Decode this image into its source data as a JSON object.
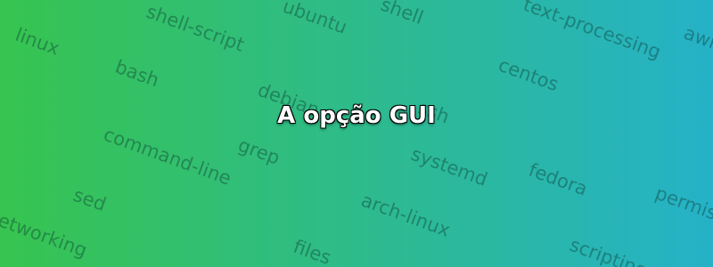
{
  "banner": {
    "gradient_start": "#37c44f",
    "gradient_end": "#25b2c8",
    "title": "A opção GUI",
    "tags": [
      "linux",
      "shell-script",
      "ubuntu",
      "shell",
      "text-processing",
      "awk",
      "bash",
      "debian",
      "centos",
      "ssh",
      "command-line",
      "grep",
      "systemd",
      "fedora",
      "permissions",
      "sed",
      "arch-linux",
      "networking",
      "files",
      "scripting"
    ]
  }
}
